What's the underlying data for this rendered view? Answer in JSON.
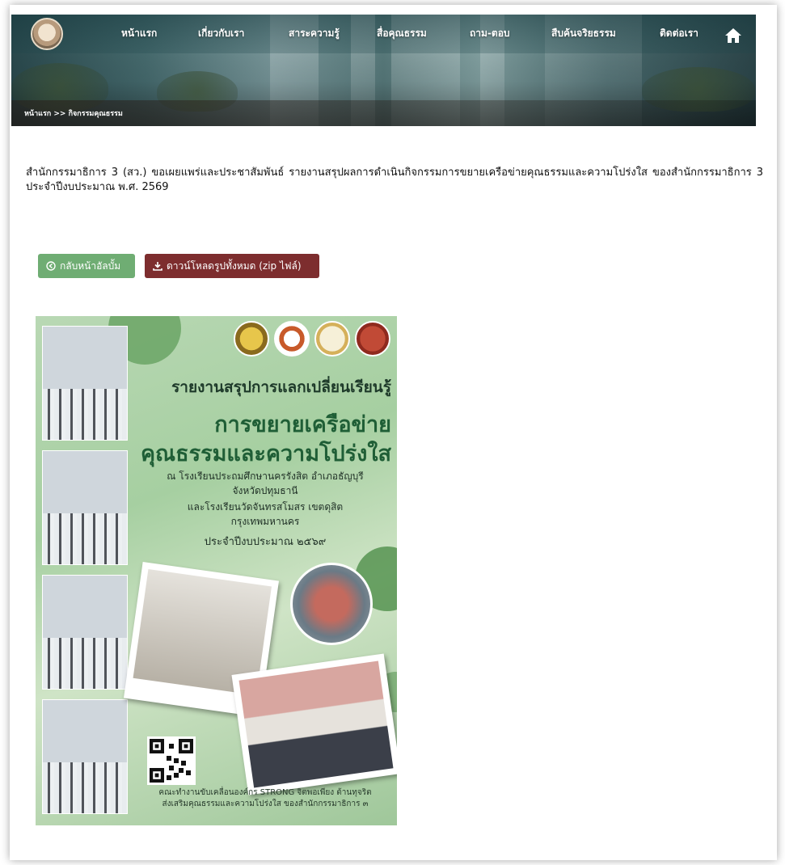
{
  "nav": {
    "items": [
      {
        "label": "หน้าแรก"
      },
      {
        "label": "เกี่ยวกับเรา"
      },
      {
        "label": "สาระความรู้"
      },
      {
        "label": "สื่อคุณธรรม"
      },
      {
        "label": "ถาม-ตอบ"
      },
      {
        "label": "สืบค้นจริยธรรม"
      },
      {
        "label": "ติดต่อเรา"
      }
    ],
    "home_icon": "home-icon"
  },
  "breadcrumb": {
    "text": "หน้าแรก >> กิจกรรมคุณธรรม"
  },
  "article": {
    "description": "สำนักกรรมาธิการ 3 (สว.) ขอเผยแพร่และประชาสัมพันธ์ รายงานสรุปผลการดำเนินกิจกรรมการขยายเครือข่ายคุณธรรมและความโปร่งใส ของสำนักกรรมาธิการ 3 ประจำปีงบประมาณ พ.ศ. 2569"
  },
  "buttons": {
    "back_label": "กลับหน้าอัลบั้ม",
    "back_icon": "arrow-left-circle-icon",
    "download_label": "ดาวน์โหลดรูปทั้งหมด (zip ไฟล์)",
    "download_icon": "download-icon"
  },
  "poster": {
    "title_line1": "รายงานสรุปการแลกเปลี่ยนเรียนรู้",
    "title_line2": "การขยายเครือข่าย",
    "title_line3": "คุณธรรมและความโปร่งใส",
    "detail_line1": "ณ โรงเรียนประถมศึกษานครรังสิต อำเภอธัญบุรี",
    "detail_line2": "จังหวัดปทุมธานี",
    "detail_line3": "และโรงเรียนวัดจันทรสโมสร เขตดุสิต",
    "detail_line4": "กรุงเทพมหานคร",
    "fiscal_year": "ประจำปีงบประมาณ ๒๕๖๙",
    "footer_line1": "คณะทำงานขับเคลื่อนองค์กร STRONG จิตพอเพียง ต้านทุจริต",
    "footer_line2": "ส่งเสริมคุณธรรมและความโปร่งใส ของสำนักกรรมาธิการ ๓",
    "colors": {
      "title_dark": "#1e3a2a",
      "title_green": "#1f5e36",
      "bg_green": "#a6cfa1"
    }
  }
}
